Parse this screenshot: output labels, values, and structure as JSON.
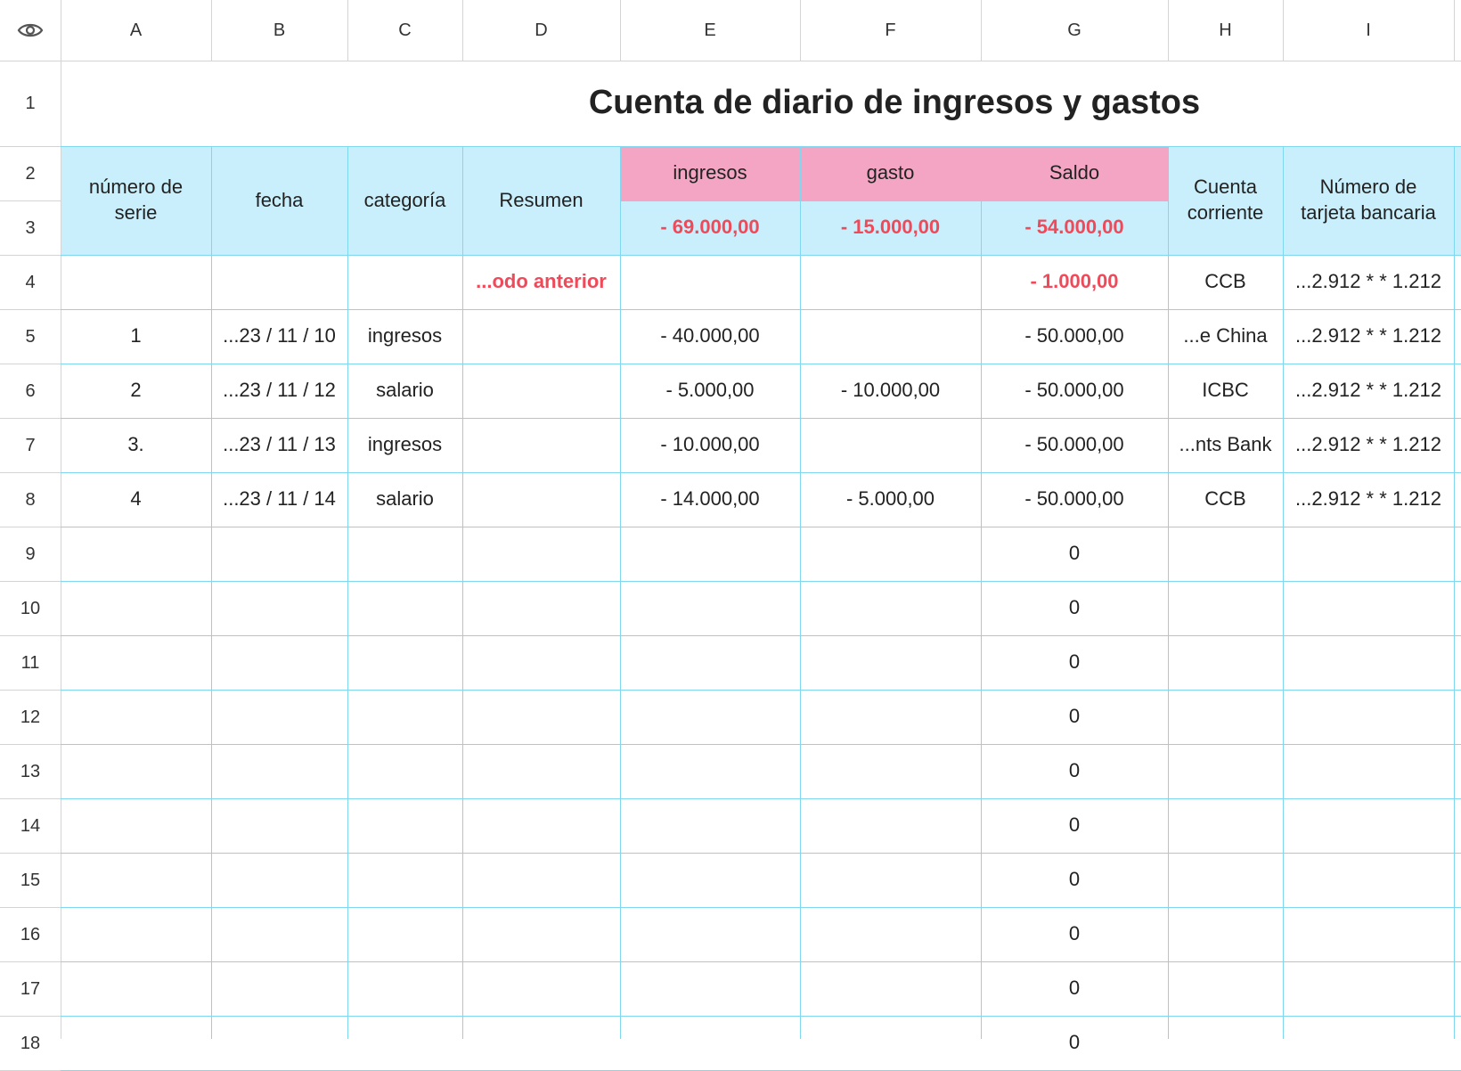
{
  "sheet": {
    "columns": [
      "A",
      "B",
      "C",
      "D",
      "E",
      "F",
      "G",
      "H",
      "I"
    ],
    "rows": [
      "1",
      "2",
      "3",
      "4",
      "5",
      "6",
      "7",
      "8",
      "9",
      "10",
      "11",
      "12",
      "13",
      "14",
      "15",
      "16",
      "17",
      "18"
    ],
    "title": "Cuenta de diario de ingresos y gastos",
    "headers": {
      "serial": "número de serie",
      "date": "fecha",
      "category": "categoría",
      "summary": "Resumen",
      "income": "ingresos",
      "expense": "gasto",
      "balance": "Saldo",
      "account": "Cuenta corriente",
      "card": "Número de tarjeta bancaria"
    },
    "totals": {
      "income": "- 69.000,00",
      "expense": "- 15.000,00",
      "balance": "- 54.000,00"
    },
    "previous": {
      "summary": "...odo anterior",
      "balance": "- 1.000,00",
      "account": "CCB",
      "card": "...2.912 * * 1.212"
    },
    "entries": [
      {
        "serial": "1",
        "date": "...23 / 11 / 10",
        "category": "ingresos",
        "summary": "",
        "income": "- 40.000,00",
        "expense": "",
        "balance": "- 50.000,00",
        "account": "...e China",
        "card": "...2.912 * * 1.212"
      },
      {
        "serial": "2",
        "date": "...23 / 11 / 12",
        "category": "salario",
        "summary": "",
        "income": "- 5.000,00",
        "expense": "- 10.000,00",
        "balance": "- 50.000,00",
        "account": "ICBC",
        "card": "...2.912 * * 1.212"
      },
      {
        "serial": "3.",
        "date": "...23 / 11 / 13",
        "category": "ingresos",
        "summary": "",
        "income": "- 10.000,00",
        "expense": "",
        "balance": "- 50.000,00",
        "account": "...nts Bank",
        "card": "...2.912 * * 1.212"
      },
      {
        "serial": "4",
        "date": "...23 / 11 / 14",
        "category": "salario",
        "summary": "",
        "income": "- 14.000,00",
        "expense": "- 5.000,00",
        "balance": "- 50.000,00",
        "account": "CCB",
        "card": "...2.912 * * 1.212"
      }
    ],
    "empty_balances": [
      "0",
      "0",
      "0",
      "0",
      "0",
      "0",
      "0",
      "0",
      "0",
      "0"
    ],
    "colors": {
      "header_bg": "#c9effc",
      "pink_bg": "#f4a5c3",
      "grid_blue": "#7fd8f0",
      "grid_gray": "#d4d4d4",
      "negative_red": "#ee4a5a"
    },
    "icons": {
      "visibility": "eye-icon"
    }
  }
}
